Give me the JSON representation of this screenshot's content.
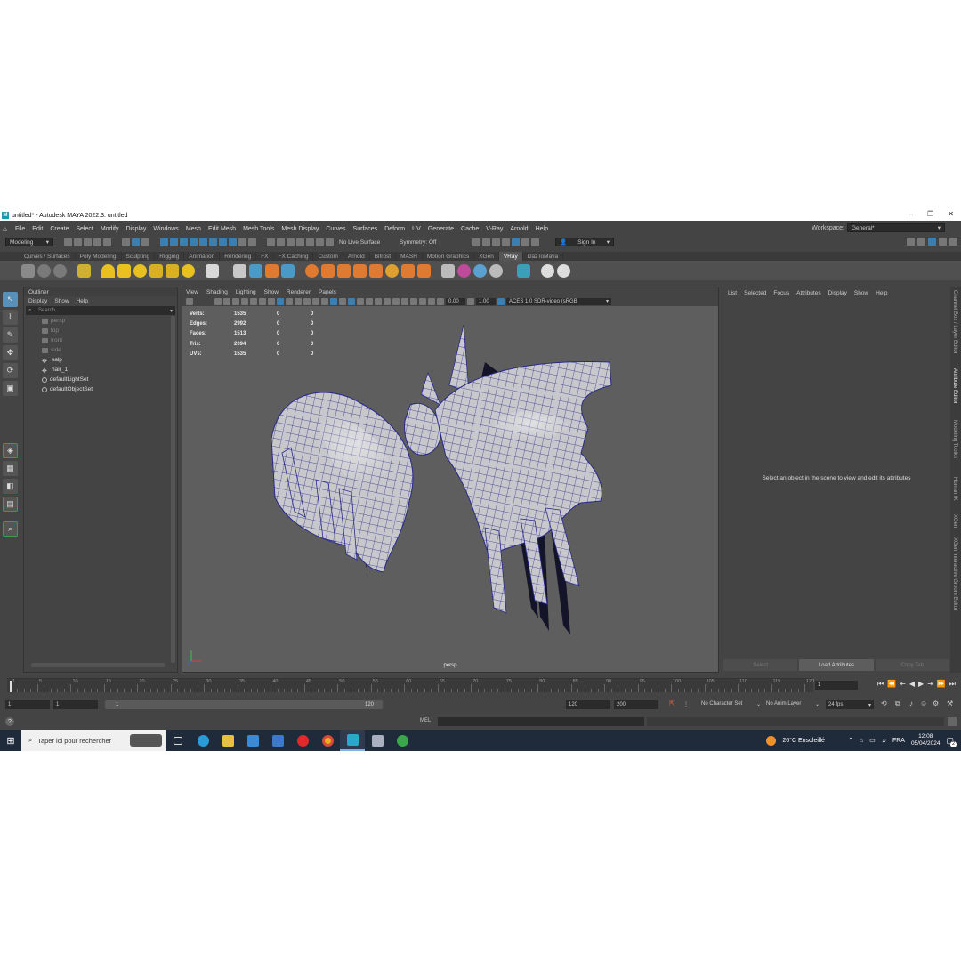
{
  "window": {
    "title": "untitled* - Autodesk MAYA 2022.3: untitled",
    "logo_letter": "M"
  },
  "menubar": {
    "items": [
      "File",
      "Edit",
      "Create",
      "Select",
      "Modify",
      "Display",
      "Windows",
      "Mesh",
      "Edit Mesh",
      "Mesh Tools",
      "Mesh Display",
      "Curves",
      "Surfaces",
      "Deform",
      "UV",
      "Generate",
      "Cache",
      "V-Ray",
      "Arnold",
      "Help"
    ],
    "workspace_label": "Workspace:",
    "workspace_value": "General*"
  },
  "statusline": {
    "mode": "Modeling",
    "live_surface": "No Live Surface",
    "symmetry": "Symmetry: Off",
    "sign_in": "Sign In"
  },
  "shelf": {
    "tabs": [
      "Curves / Surfaces",
      "Poly Modeling",
      "Sculpting",
      "Rigging",
      "Animation",
      "Rendering",
      "FX",
      "FX Caching",
      "Custom",
      "Arnold",
      "Bifrost",
      "MASH",
      "Motion Graphics",
      "XGen",
      "VRay",
      "DazToMaya"
    ],
    "active_tab": "VRay"
  },
  "outliner": {
    "title": "Outliner",
    "menu": [
      "Display",
      "Show",
      "Help"
    ],
    "search_placeholder": "Search...",
    "items": [
      {
        "label": "persp",
        "dim": true
      },
      {
        "label": "top",
        "dim": true
      },
      {
        "label": "front",
        "dim": true
      },
      {
        "label": "side",
        "dim": true
      },
      {
        "label": "salp",
        "dim": false
      },
      {
        "label": "hair_1",
        "dim": false
      },
      {
        "label": "defaultLightSet",
        "dim": false
      },
      {
        "label": "defaultObjectSet",
        "dim": false
      }
    ]
  },
  "viewport": {
    "menu": [
      "View",
      "Shading",
      "Lighting",
      "Show",
      "Renderer",
      "Panels"
    ],
    "field_a": "0.00",
    "field_b": "1.00",
    "colorspace": "ACES 1.0 SDR-video (sRGB",
    "camera_label": "persp",
    "hud": [
      {
        "label": "Verts:",
        "v1": "1535",
        "v2": "0",
        "v3": "0"
      },
      {
        "label": "Edges:",
        "v1": "2992",
        "v2": "0",
        "v3": "0"
      },
      {
        "label": "Faces:",
        "v1": "1513",
        "v2": "0",
        "v3": "0"
      },
      {
        "label": "Tris:",
        "v1": "2094",
        "v2": "0",
        "v3": "0"
      },
      {
        "label": "UVs:",
        "v1": "1535",
        "v2": "0",
        "v3": "0"
      }
    ]
  },
  "attribute_editor": {
    "menu": [
      "List",
      "Selected",
      "Focus",
      "Attributes",
      "Display",
      "Show",
      "Help"
    ],
    "message": "Select an object in the scene to view and edit its attributes",
    "buttons": [
      "Select",
      "Load Attributes",
      "Copy Tab"
    ]
  },
  "side_tabs": [
    "Channel Box / Layer Editor",
    "Attribute Editor",
    "Modeling Toolkit",
    "Human IK",
    "XGen",
    "XGen Interactive Groom Editor"
  ],
  "timeslider": {
    "ticks": [
      "1",
      "5",
      "10",
      "15",
      "20",
      "25",
      "30",
      "35",
      "40",
      "45",
      "50",
      "55",
      "60",
      "65",
      "70",
      "75",
      "80",
      "85",
      "90",
      "95",
      "100",
      "105",
      "110",
      "115",
      "120"
    ],
    "current_frame": "1"
  },
  "range": {
    "start": "1",
    "playback_start": "1",
    "slider_start": "1",
    "slider_end": "120",
    "playback_end": "120",
    "end": "200",
    "character_set": "No Character Set",
    "anim_layer": "No Anim Layer",
    "fps": "24 fps"
  },
  "command_line": {
    "language": "MEL"
  },
  "taskbar": {
    "search_placeholder": "Taper ici pour rechercher",
    "weather": "26°C  Ensoleillé",
    "language": "FRA",
    "time": "12:08",
    "date": "05/04/2024",
    "notifications": "2"
  },
  "colors": {
    "accent": "#5890b8",
    "maya_logo": "#29a9c8",
    "mesh_wire": "#2a2a8a",
    "mesh_fill": "#c8c8cc"
  }
}
